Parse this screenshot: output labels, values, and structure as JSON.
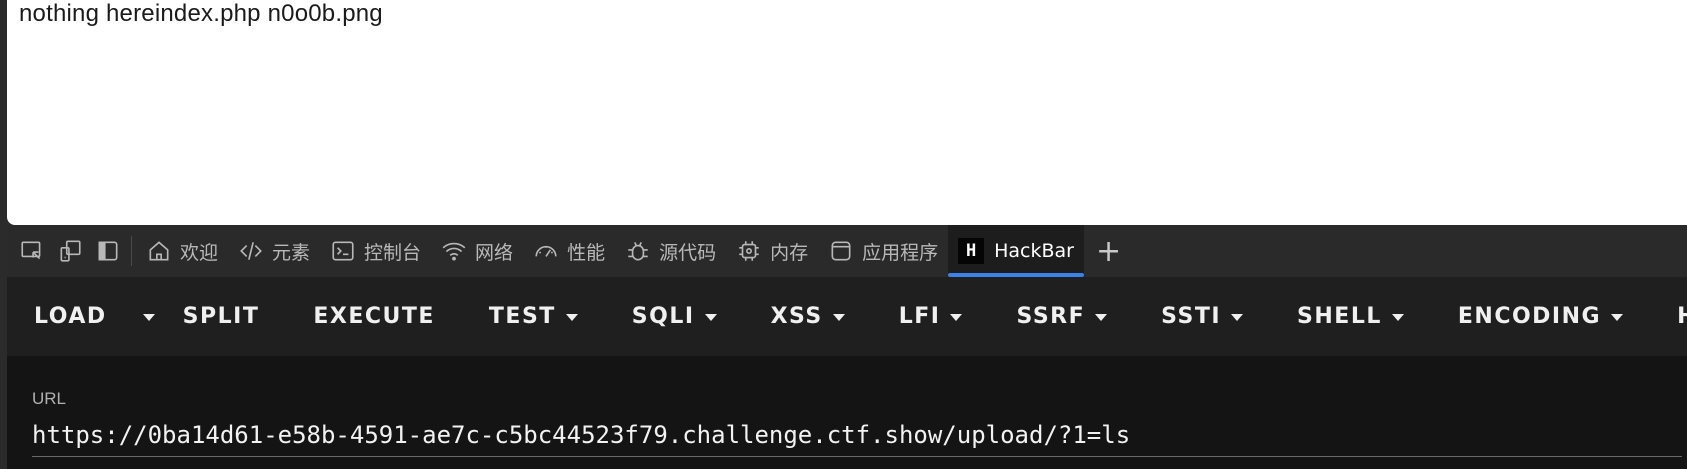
{
  "page": {
    "content_text": "nothing hereindex.php n0o0b.png"
  },
  "devtools": {
    "tabs": [
      {
        "label": "欢迎",
        "icon": "home-icon"
      },
      {
        "label": "元素",
        "icon": "code-icon"
      },
      {
        "label": "控制台",
        "icon": "console-icon"
      },
      {
        "label": "网络",
        "icon": "wifi-icon"
      },
      {
        "label": "性能",
        "icon": "gauge-icon"
      },
      {
        "label": "源代码",
        "icon": "bug-icon"
      },
      {
        "label": "内存",
        "icon": "chip-icon"
      },
      {
        "label": "应用程序",
        "icon": "app-icon"
      }
    ],
    "active_tab": {
      "label": "HackBar",
      "logo_text": "H"
    },
    "new_tab_label": "+"
  },
  "hackbar": {
    "buttons": [
      "LOAD",
      "SPLIT",
      "EXECUTE",
      "TEST",
      "SQLI",
      "XSS",
      "LFI",
      "SSRF",
      "SSTI",
      "SHELL",
      "ENCODING",
      "HAS"
    ],
    "url_label": "URL",
    "url_value": "https://0ba14d61-e58b-4591-ae7c-c5bc44523f79.challenge.ctf.show/upload/?1=ls"
  },
  "colors": {
    "accent": "#3b82e8",
    "toolbar_bg": "#1f1f1f",
    "url_panel_bg": "#141414"
  }
}
